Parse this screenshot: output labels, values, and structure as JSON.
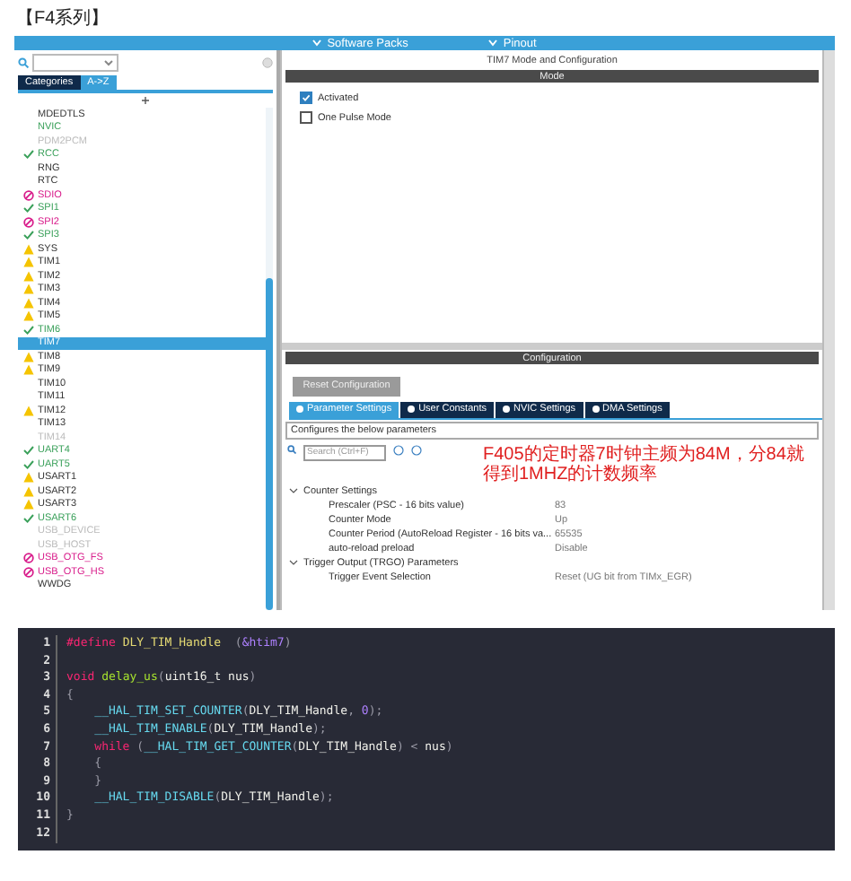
{
  "title": "【F4系列】",
  "top_bar": {
    "items": [
      "Software Packs",
      "Pinout"
    ]
  },
  "sidebar": {
    "tabs": [
      {
        "label": "Categories",
        "selected": false
      },
      {
        "label": "A->Z",
        "selected": true
      }
    ],
    "items": [
      {
        "label": "MDEDTLS",
        "kind": "plain",
        "selected": false
      },
      {
        "label": "NVIC",
        "kind": "configured",
        "selected": false
      },
      {
        "label": "PDM2PCM",
        "kind": "disabled",
        "selected": false
      },
      {
        "label": "RCC",
        "kind": "ok",
        "selected": false
      },
      {
        "label": "RNG",
        "kind": "plain",
        "selected": false
      },
      {
        "label": "RTC",
        "kind": "plain",
        "selected": false
      },
      {
        "label": "SDIO",
        "kind": "error",
        "selected": false
      },
      {
        "label": "SPI1",
        "kind": "ok",
        "selected": false
      },
      {
        "label": "SPI2",
        "kind": "error",
        "selected": false
      },
      {
        "label": "SPI3",
        "kind": "ok",
        "selected": false
      },
      {
        "label": "SYS",
        "kind": "warn",
        "selected": false
      },
      {
        "label": "TIM1",
        "kind": "warn",
        "selected": false
      },
      {
        "label": "TIM2",
        "kind": "warn",
        "selected": false
      },
      {
        "label": "TIM3",
        "kind": "warn",
        "selected": false
      },
      {
        "label": "TIM4",
        "kind": "warn",
        "selected": false
      },
      {
        "label": "TIM5",
        "kind": "warn",
        "selected": false
      },
      {
        "label": "TIM6",
        "kind": "ok",
        "selected": false
      },
      {
        "label": "TIM7",
        "kind": "plain",
        "selected": true
      },
      {
        "label": "TIM8",
        "kind": "warn",
        "selected": false
      },
      {
        "label": "TIM9",
        "kind": "warn",
        "selected": false
      },
      {
        "label": "TIM10",
        "kind": "plain",
        "selected": false
      },
      {
        "label": "TIM11",
        "kind": "plain",
        "selected": false
      },
      {
        "label": "TIM12",
        "kind": "warn",
        "selected": false
      },
      {
        "label": "TIM13",
        "kind": "plain",
        "selected": false
      },
      {
        "label": "TIM14",
        "kind": "disabled",
        "selected": false
      },
      {
        "label": "UART4",
        "kind": "ok",
        "selected": false
      },
      {
        "label": "UART5",
        "kind": "ok",
        "selected": false
      },
      {
        "label": "USART1",
        "kind": "warn",
        "selected": false
      },
      {
        "label": "USART2",
        "kind": "warn",
        "selected": false
      },
      {
        "label": "USART3",
        "kind": "warn",
        "selected": false
      },
      {
        "label": "USART6",
        "kind": "ok",
        "selected": false
      },
      {
        "label": "USB_DEVICE",
        "kind": "disabled",
        "selected": false
      },
      {
        "label": "USB_HOST",
        "kind": "disabled",
        "selected": false
      },
      {
        "label": "USB_OTG_FS",
        "kind": "error",
        "selected": false
      },
      {
        "label": "USB_OTG_HS",
        "kind": "error",
        "selected": false
      },
      {
        "label": "WWDG",
        "kind": "plain",
        "selected": false
      }
    ]
  },
  "panel": {
    "title": "TIM7 Mode and Configuration",
    "mode_header": "Mode",
    "mode_options": [
      {
        "label": "Activated",
        "checked": true
      },
      {
        "label": "One Pulse Mode",
        "checked": false
      }
    ],
    "config_header": "Configuration",
    "reset_button": "Reset Configuration",
    "tabs": [
      {
        "label": "Parameter Settings",
        "selected": true
      },
      {
        "label": "User Constants",
        "selected": false
      },
      {
        "label": "NVIC Settings",
        "selected": false
      },
      {
        "label": "DMA Settings",
        "selected": false
      }
    ],
    "hint": "Configures the below parameters",
    "search": {
      "placeholder": "Search (Ctrl+F)"
    },
    "annotation": "F405的定时器7时钟主频为84M，分84就得到1MHZ的计数频率",
    "groups": [
      {
        "label": "Counter Settings",
        "expanded": true,
        "params": [
          {
            "name": "Prescaler (PSC - 16 bits value)",
            "value": "83"
          },
          {
            "name": "Counter Mode",
            "value": "Up"
          },
          {
            "name": "Counter Period (AutoReload Register - 16 bits va...",
            "value": "65535"
          },
          {
            "name": "auto-reload preload",
            "value": "Disable"
          }
        ]
      },
      {
        "label": "Trigger Output (TRGO) Parameters",
        "expanded": true,
        "params": [
          {
            "name": "Trigger Event Selection",
            "value": "Reset (UG bit from TIMx_EGR)"
          }
        ]
      }
    ]
  },
  "code": {
    "lines": [
      {
        "number": "1",
        "tokens": [
          {
            "text": "#define ",
            "kind": "keyword"
          },
          {
            "text": "DLY_TIM_Handle",
            "kind": "def"
          },
          {
            "text": "  (",
            "kind": "punct"
          },
          {
            "text": "&htim7",
            "kind": "num"
          },
          {
            "text": ")",
            "kind": "punct"
          }
        ]
      },
      {
        "number": "2"
      },
      {
        "number": "3",
        "tokens": [
          {
            "text": "void ",
            "kind": "keyword"
          },
          {
            "text": "delay_us",
            "kind": "func"
          },
          {
            "text": "(",
            "kind": "punct"
          },
          {
            "text": "uint16_t nus",
            "kind": "name"
          },
          {
            "text": ")",
            "kind": "punct"
          }
        ]
      },
      {
        "number": "4",
        "tokens": [
          {
            "text": "{",
            "kind": "punct"
          }
        ]
      },
      {
        "number": "5",
        "tokens": [
          {
            "text": "    __HAL_TIM_SET_COUNTER",
            "kind": "macro"
          },
          {
            "text": "(",
            "kind": "punct"
          },
          {
            "text": "DLY_TIM_Handle",
            "kind": "name"
          },
          {
            "text": ", ",
            "kind": "punct"
          },
          {
            "text": "0",
            "kind": "num"
          },
          {
            "text": ");",
            "kind": "punct"
          }
        ]
      },
      {
        "number": "6",
        "tokens": [
          {
            "text": "    __HAL_TIM_ENABLE",
            "kind": "macro"
          },
          {
            "text": "(",
            "kind": "punct"
          },
          {
            "text": "DLY_TIM_Handle",
            "kind": "name"
          },
          {
            "text": ");",
            "kind": "punct"
          }
        ]
      },
      {
        "number": "7",
        "tokens": [
          {
            "text": "    while",
            "kind": "keyword"
          },
          {
            "text": " (",
            "kind": "punct"
          },
          {
            "text": "__HAL_TIM_GET_COUNTER",
            "kind": "macro"
          },
          {
            "text": "(",
            "kind": "punct"
          },
          {
            "text": "DLY_TIM_Handle",
            "kind": "name"
          },
          {
            "text": ") < ",
            "kind": "punct"
          },
          {
            "text": "nus",
            "kind": "name"
          },
          {
            "text": ")",
            "kind": "punct"
          }
        ]
      },
      {
        "number": "8",
        "tokens": [
          {
            "text": "    {",
            "kind": "punct"
          }
        ]
      },
      {
        "number": "9",
        "tokens": [
          {
            "text": "    }",
            "kind": "punct"
          }
        ]
      },
      {
        "number": "10",
        "tokens": [
          {
            "text": "    __HAL_TIM_DISABLE",
            "kind": "macro"
          },
          {
            "text": "(",
            "kind": "punct"
          },
          {
            "text": "DLY_TIM_Handle",
            "kind": "name"
          },
          {
            "text": ");",
            "kind": "punct"
          }
        ]
      },
      {
        "number": "11",
        "tokens": [
          {
            "text": "}",
            "kind": "punct"
          }
        ]
      },
      {
        "number": "12"
      }
    ]
  }
}
